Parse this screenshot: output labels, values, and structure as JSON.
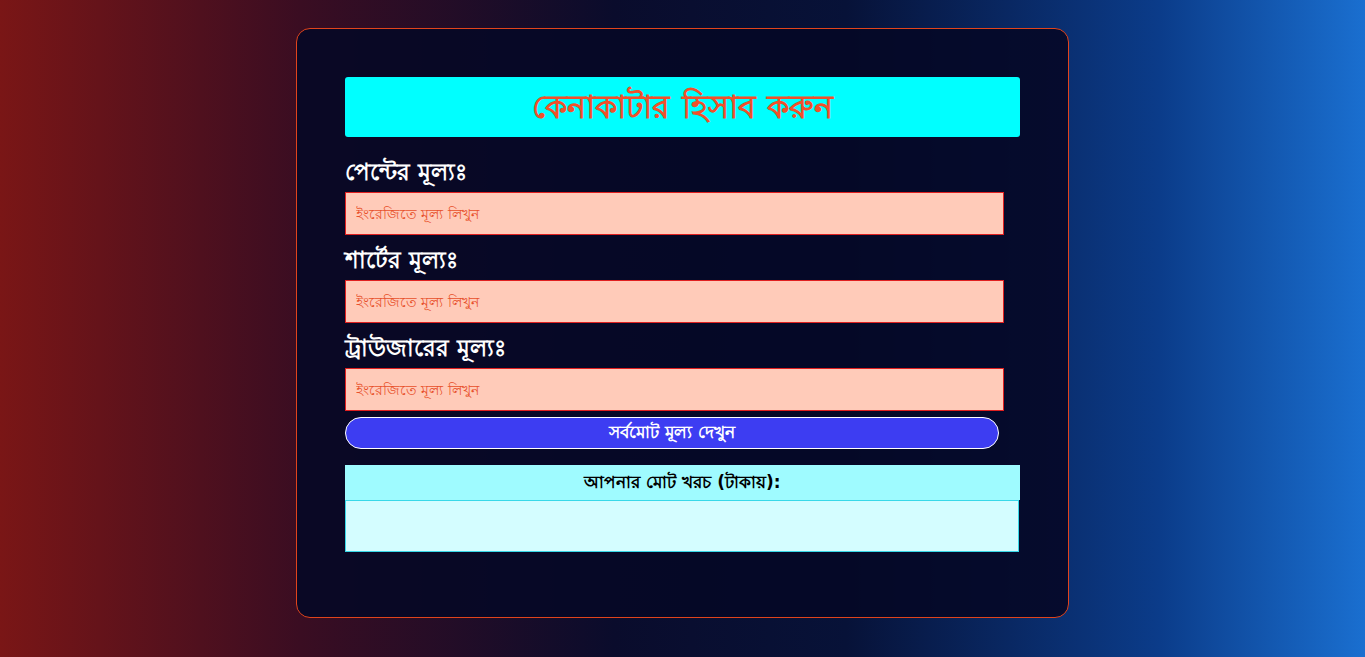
{
  "title": "কেনাকাটার হিসাব করুন",
  "fields": [
    {
      "label": "পেন্টের মূল্যঃ",
      "placeholder": "ইংরেজিতে মূল্য লিখুন"
    },
    {
      "label": "শার্টের মূল্যঃ",
      "placeholder": "ইংরেজিতে মূল্য লিখুন"
    },
    {
      "label": "ট্রাউজারের মূল্যঃ",
      "placeholder": "ইংরেজিতে মূল্য লিখুন"
    }
  ],
  "button": "সর্বমোট মূল্য দেখুন",
  "result": {
    "label": "আপনার মোট খরচ (টাকায়):"
  }
}
